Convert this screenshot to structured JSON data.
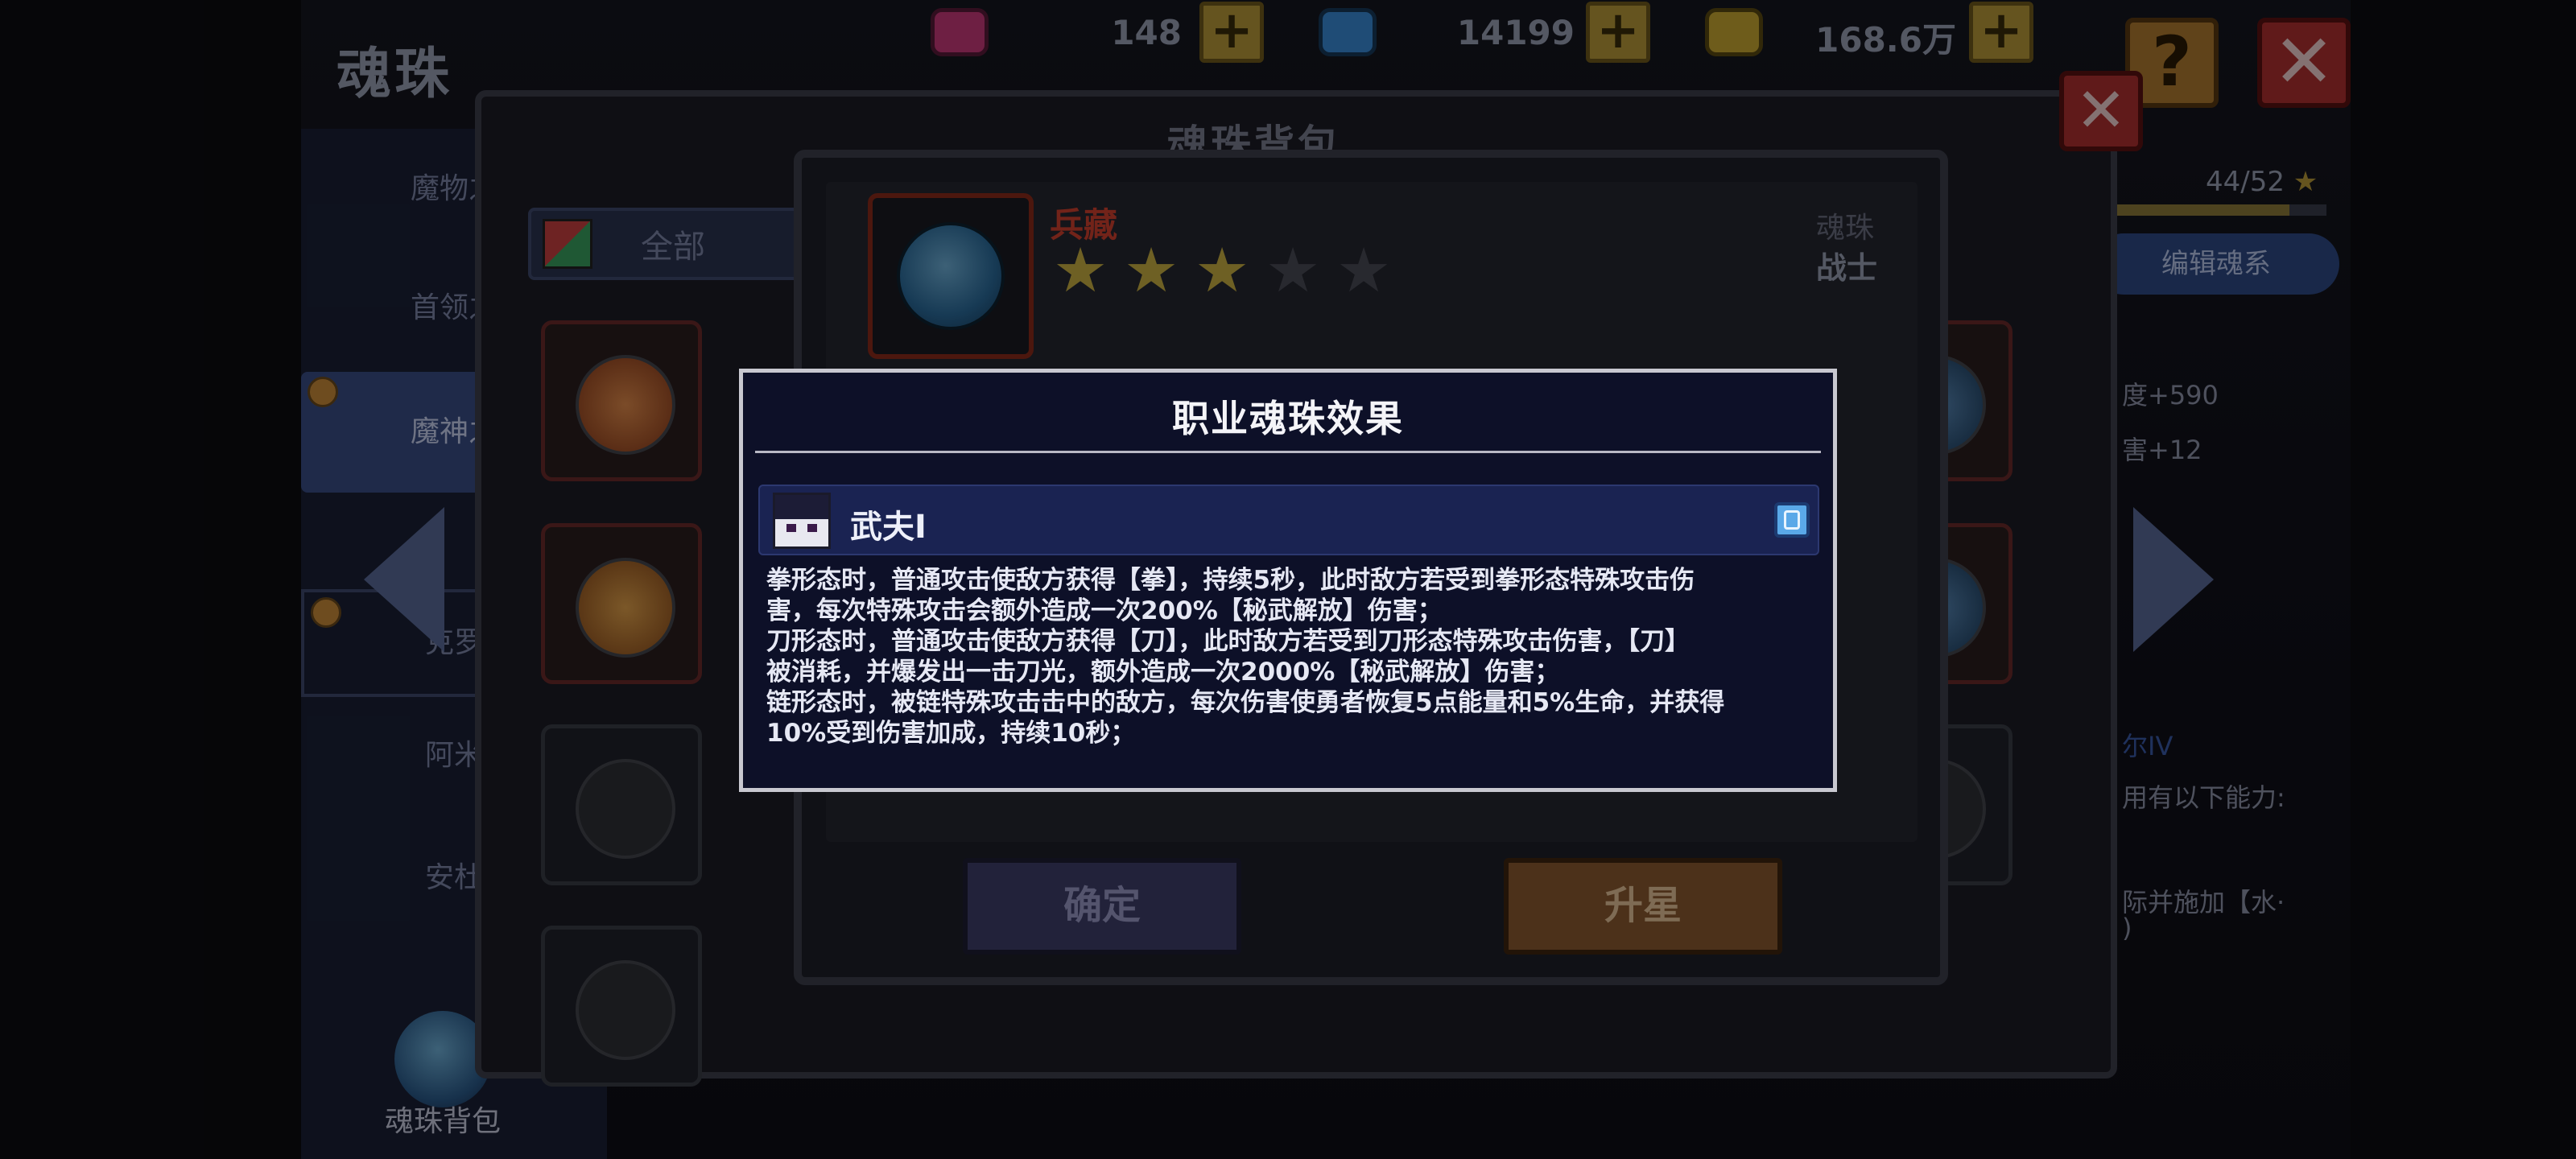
{
  "header": {
    "title": "魂珠",
    "currencies": [
      {
        "icon": "pink-gem-icon",
        "value": "148",
        "color": "#c83a7a"
      },
      {
        "icon": "blue-gem-icon",
        "value": "14199",
        "color": "#3a8ad8"
      },
      {
        "icon": "gold-coin-icon",
        "value": "168.6万",
        "color": "#c8a832"
      }
    ],
    "help_label": "?",
    "close_label": "✕"
  },
  "sidebar": {
    "items": [
      {
        "label": "魔物之"
      },
      {
        "label": "首领之"
      },
      {
        "label": "魔神之"
      },
      {
        "label": "克罗"
      },
      {
        "label": "阿米"
      },
      {
        "label": "安杜"
      }
    ],
    "bag_label": "魂珠背包"
  },
  "right_panel": {
    "star_count": "44/52",
    "star_progress": 0.846,
    "edit_label": "编辑魂系",
    "lines": [
      "度+590",
      "害+12",
      "尔IV",
      "用有以下能力:",
      "际并施加【水·",
      ")"
    ]
  },
  "bag": {
    "title": "魂珠背包",
    "filter_label": "全部",
    "close_label": "✕"
  },
  "detail": {
    "soul_name": "兵藏",
    "stars_filled": 3,
    "stars_total": 5,
    "type_label": "魂珠",
    "class_label": "战士",
    "confirm_label": "确定",
    "upstar_label": "升星"
  },
  "modal": {
    "title": "职业魂珠效果",
    "job_name": "武夫Ⅰ",
    "lines": [
      "拳形态时，普通攻击使敌方获得【拳】，持续5秒，此时敌方若受到拳形态特殊攻击伤",
      "害，每次特殊攻击会额外造成一次200%【秘武解放】伤害；",
      "刀形态时，普通攻击使敌方获得【刀】，此时敌方若受到刀形态特殊攻击伤害，【刀】",
      "被消耗，并爆发出一击刀光，额外造成一次2000%【秘武解放】伤害；",
      "链形态时，被链特殊攻击击中的敌方，每次伤害使勇者恢复5点能量和5%生命，并获得",
      "10%受到伤害加成，持续10秒；"
    ]
  }
}
